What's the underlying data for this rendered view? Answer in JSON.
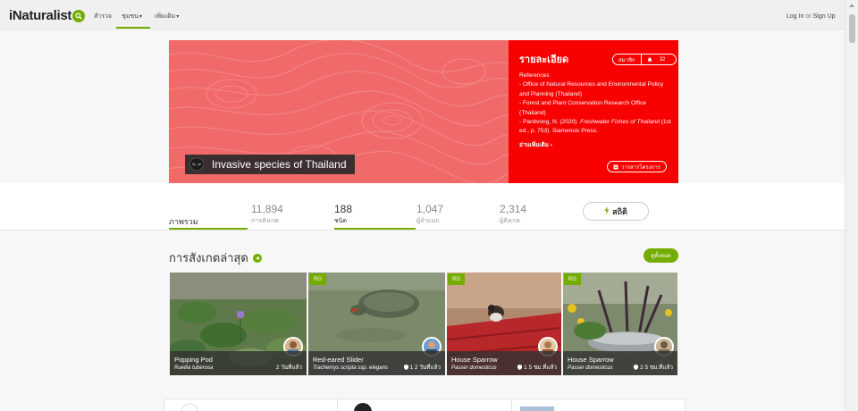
{
  "nav": {
    "logo": "iNaturalist",
    "items": [
      {
        "label": "สำรวจ",
        "caret": ""
      },
      {
        "label": "ชุมชน",
        "caret": "▾"
      },
      {
        "label": "เพิ่มเติม",
        "caret": "▾"
      }
    ],
    "login": "Log In",
    "or": "or",
    "signup": "Sign Up"
  },
  "project": {
    "title": "Invasive species of Thailand",
    "banner_color": "#f06a6a",
    "details_color": "#f80000",
    "details_heading": "รายละเอียด",
    "join_label": "สมาชิก",
    "bell_count": "32",
    "references_heading": "References",
    "references": [
      "- Office of Natural Resources and Environmental Policy and Planning (Thailand)",
      "- Forest and Plant Conservation Research Office (Thailand)"
    ],
    "ref3_prefix": "- Panitvong, N. (2020). ",
    "ref3_title": "Freshwater Fishes of Thailand",
    "ref3_suffix": " (1st ed., p. 753). Siamensis Press.",
    "read_more": "อ่านเพิ่มเติม ›",
    "journal": "วารสารโครงการ"
  },
  "stats": {
    "overview": "ภาพรวม",
    "observations": {
      "num": "11,894",
      "label": "การสังเกต"
    },
    "species": {
      "num": "188",
      "label": "ชนิด"
    },
    "identifiers": {
      "num": "1,047",
      "label": "ผู้จำแนก"
    },
    "observers": {
      "num": "2,314",
      "label": "ผู้สังเกต"
    },
    "stats_button": "สถิติ"
  },
  "recent": {
    "title": "การสังเกตล่าสุด",
    "view_all": "ดูทั้งหมด",
    "cards": [
      {
        "rg": "",
        "name": "Popping Pod",
        "sci": "Ruellia tuberosa",
        "time": "2 วันที่แล้ว"
      },
      {
        "rg": "RG",
        "name": "Red-eared Slider",
        "sci": "Trachemys scripta ssp. elegans",
        "time": "1 2 วันที่แล้ว"
      },
      {
        "rg": "RG",
        "name": "House Sparrow",
        "sci": "Passer domesticus",
        "time": "1 5 ชม.ที่แล้ว"
      },
      {
        "rg": "RG",
        "name": "House Sparrow",
        "sci": "Passer domesticus",
        "time": "2 5 ชม.ที่แล้ว"
      }
    ]
  },
  "accent_color": "#74ac00"
}
